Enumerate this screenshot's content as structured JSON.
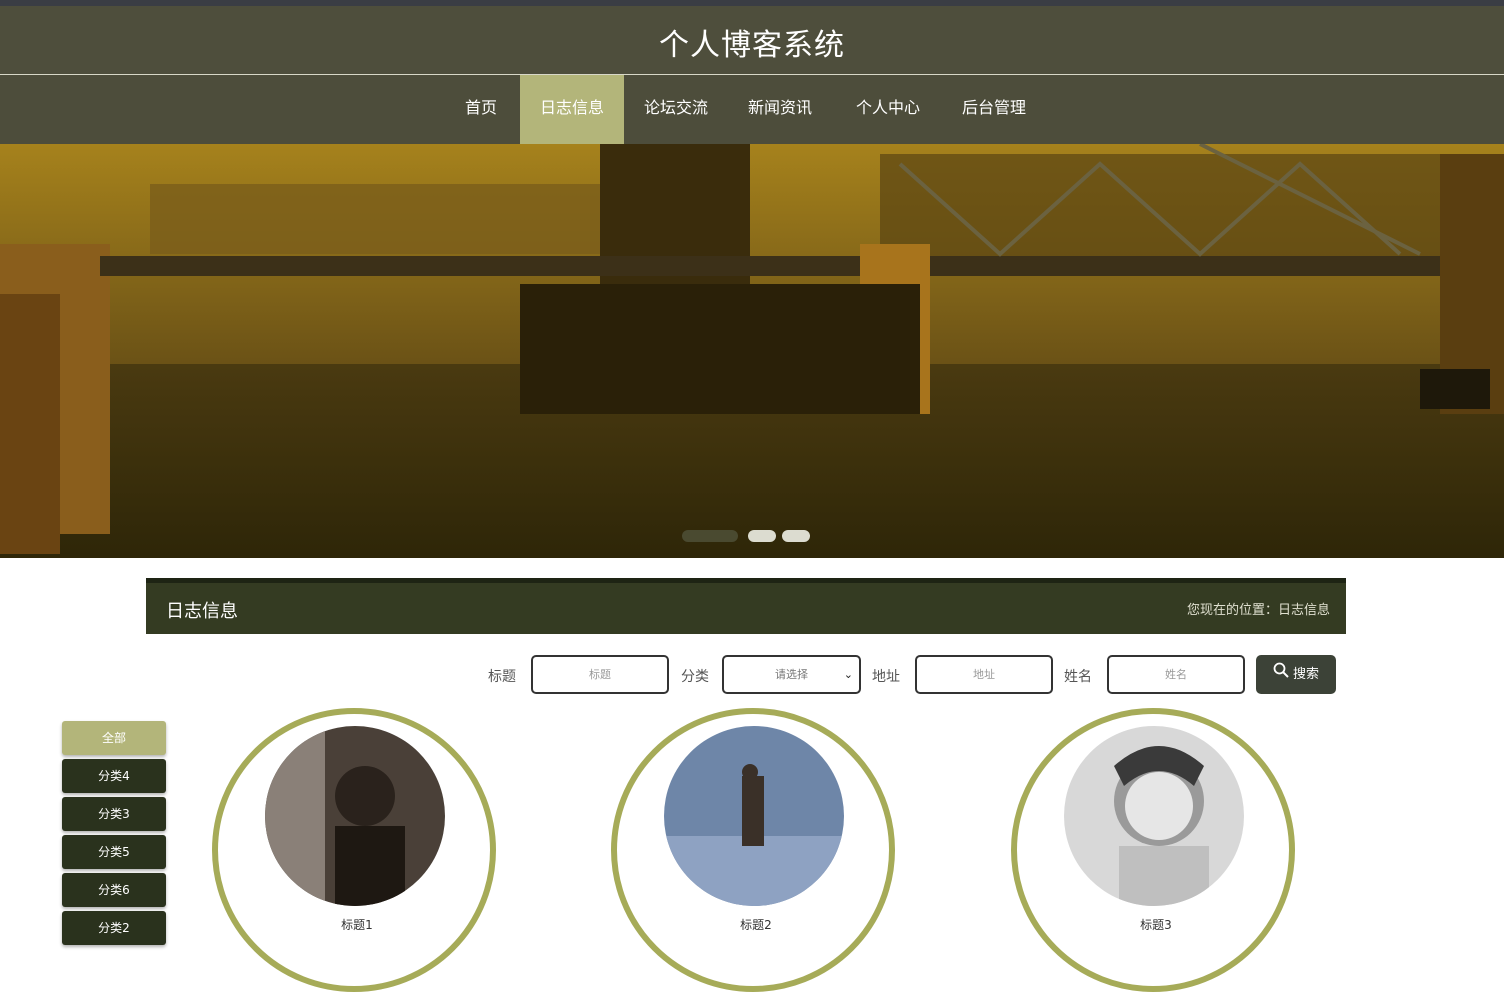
{
  "header": {
    "title": "个人博客系统"
  },
  "nav": {
    "items": [
      {
        "label": "首页",
        "active": false
      },
      {
        "label": "日志信息",
        "active": true
      },
      {
        "label": "论坛交流",
        "active": false
      },
      {
        "label": "新闻资讯",
        "active": false
      },
      {
        "label": "个人中心",
        "active": false
      },
      {
        "label": "后台管理",
        "active": false
      }
    ]
  },
  "banner": {
    "slide_count": 3,
    "active_slide": 1
  },
  "section": {
    "title": "日志信息",
    "breadcrumb": "您现在的位置：日志信息"
  },
  "filters": {
    "title_label": "标题",
    "title_placeholder": "标题",
    "category_label": "分类",
    "category_value": "请选择",
    "address_label": "地址",
    "address_placeholder": "地址",
    "name_label": "姓名",
    "name_placeholder": "姓名",
    "search_label": "搜索"
  },
  "sidebar": {
    "items": [
      {
        "label": "全部",
        "active": true
      },
      {
        "label": "分类4",
        "active": false
      },
      {
        "label": "分类3",
        "active": false
      },
      {
        "label": "分类5",
        "active": false
      },
      {
        "label": "分类6",
        "active": false
      },
      {
        "label": "分类2",
        "active": false
      }
    ]
  },
  "cards": [
    {
      "title": "标题1"
    },
    {
      "title": "标题2"
    },
    {
      "title": "标题3"
    }
  ],
  "colors": {
    "header_bg": "#4e4e3c",
    "accent": "#b3b57a",
    "section_bar": "#343b22",
    "ring": "#a6ab58"
  }
}
